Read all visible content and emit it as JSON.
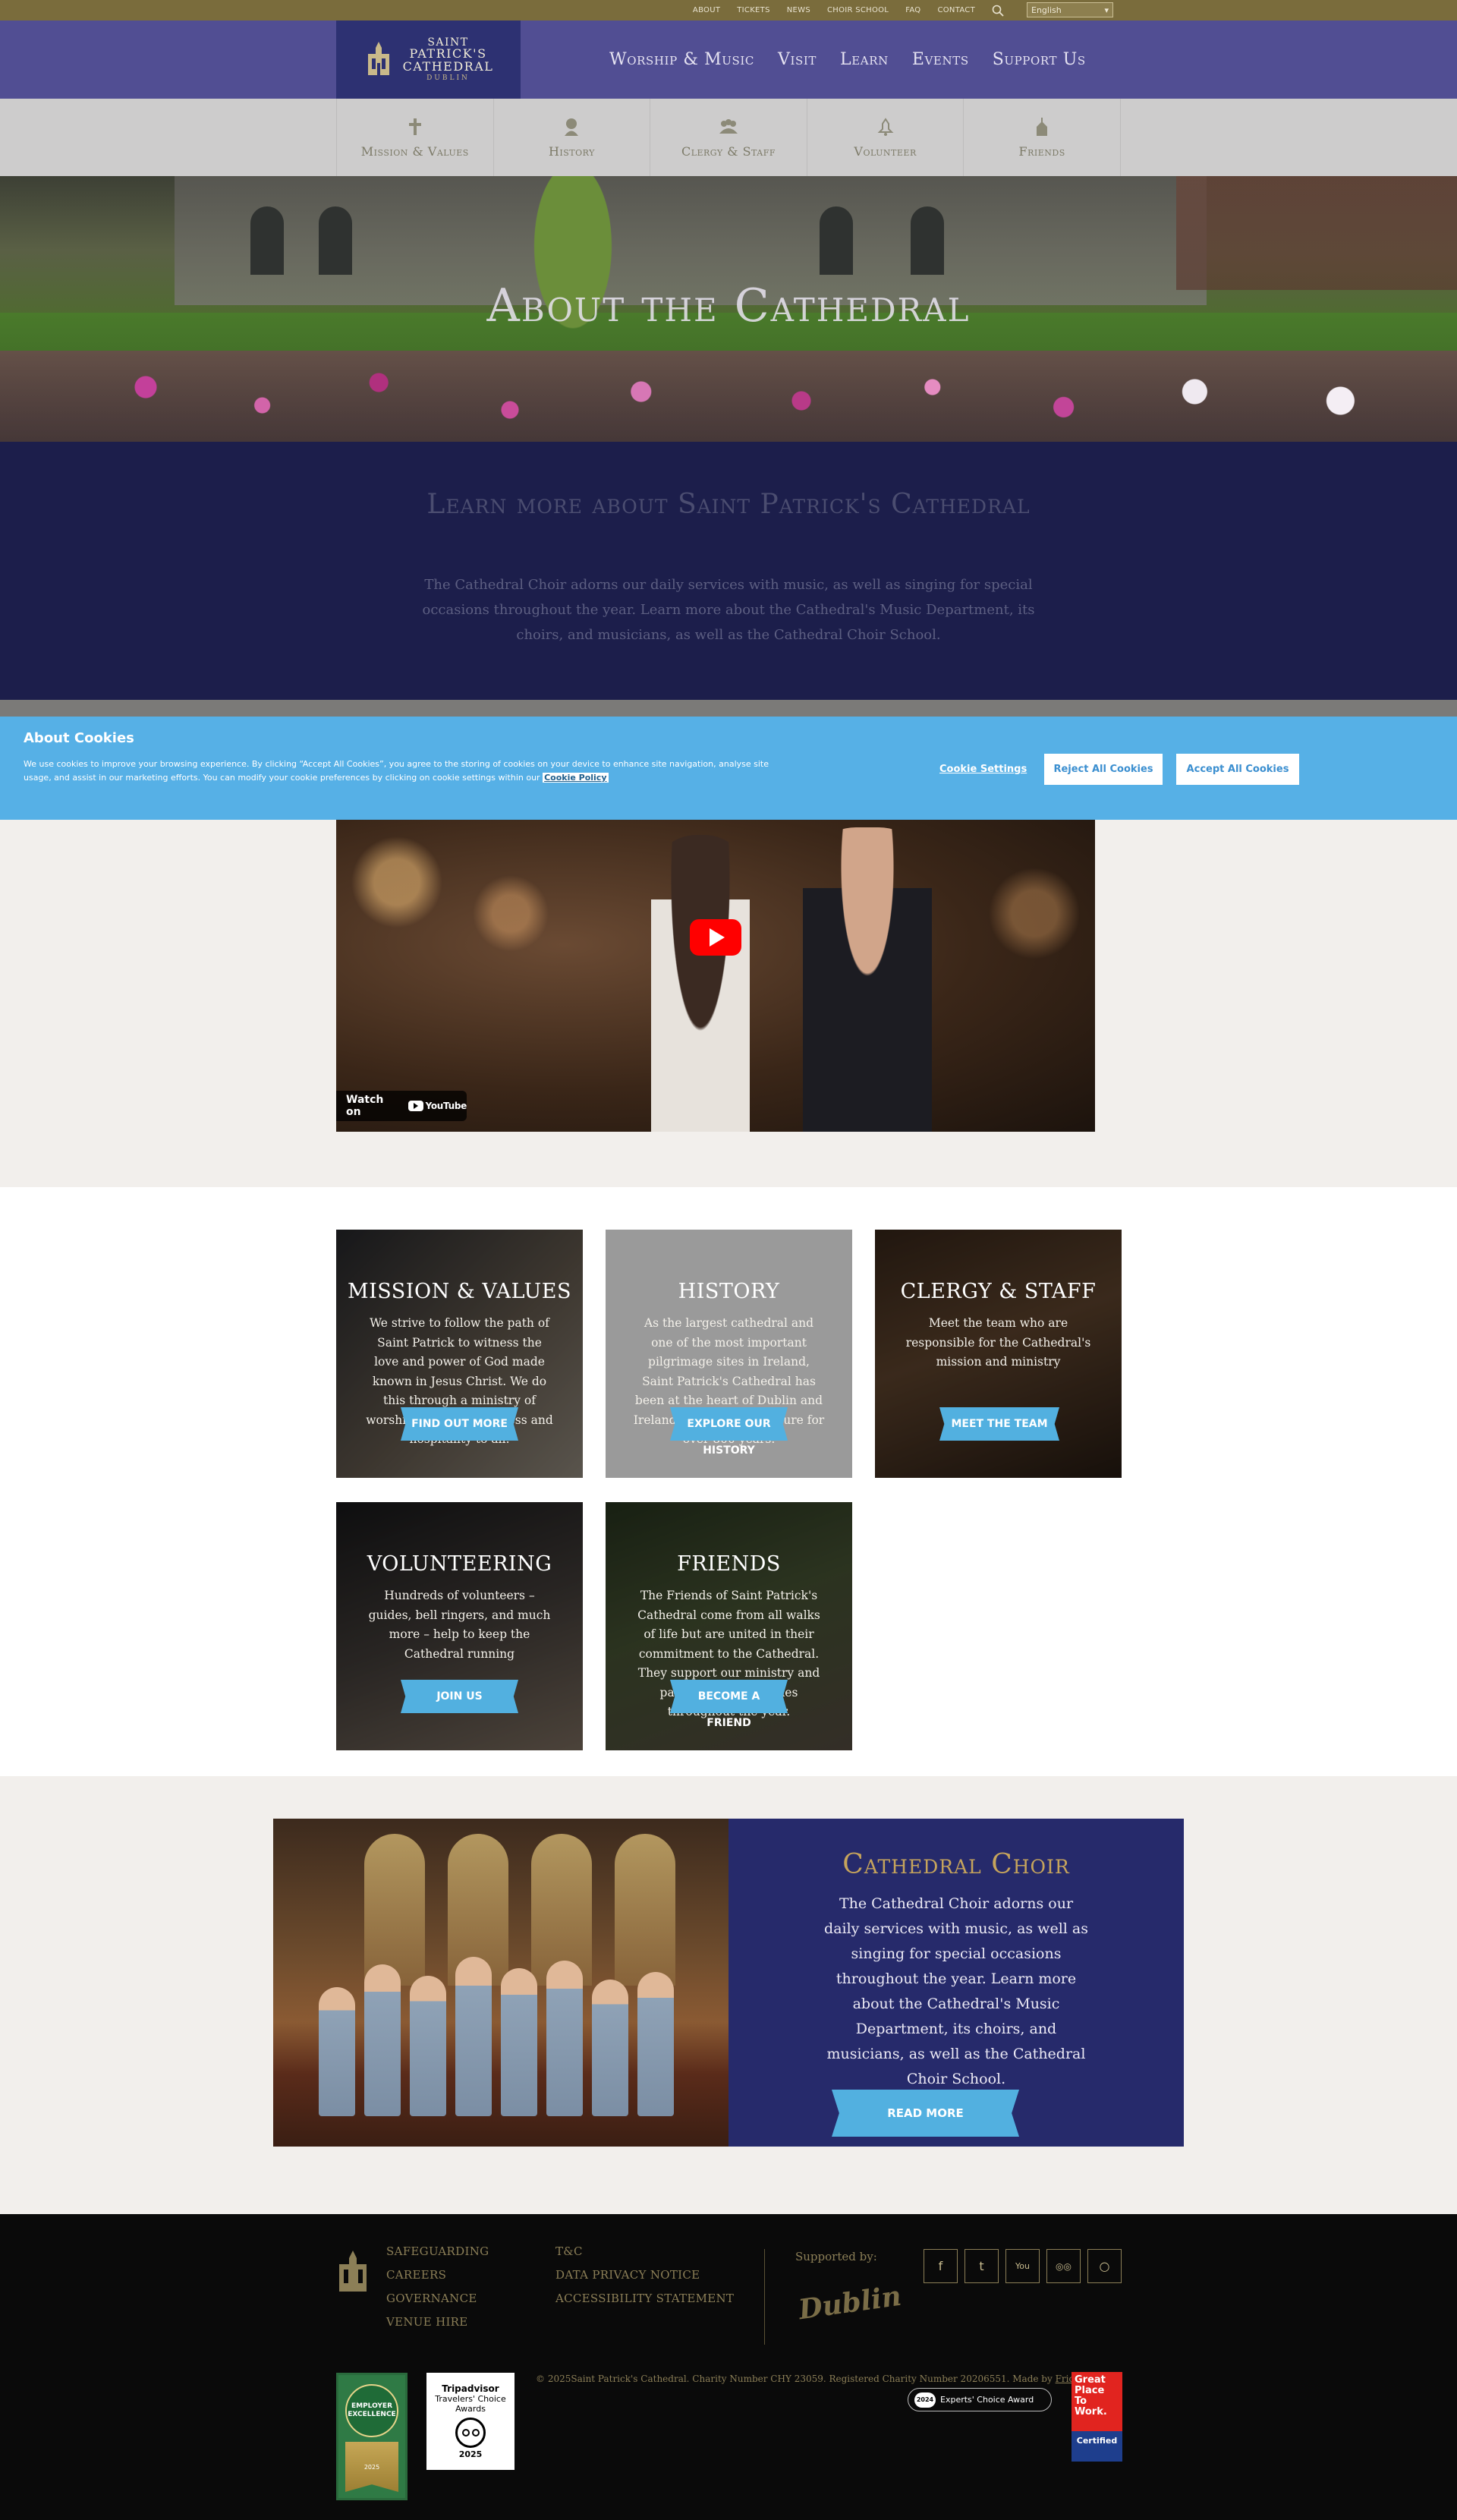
{
  "util_nav": {
    "items": [
      "ABOUT",
      "TICKETS",
      "NEWS",
      "CHOIR SCHOOL",
      "FAQ",
      "CONTACT"
    ],
    "language": "English"
  },
  "logo": {
    "line1": "SAINT",
    "line2": "PATRICK'S",
    "line3": "CATHEDRAL",
    "line4": "DUBLIN"
  },
  "main_nav": [
    "Worship & Music",
    "Visit",
    "Learn",
    "Events",
    "Support Us"
  ],
  "sub_nav": [
    {
      "label": "Mission & Values",
      "icon": "cross-icon"
    },
    {
      "label": "History",
      "icon": "bust-icon"
    },
    {
      "label": "Clergy & Staff",
      "icon": "people-icon"
    },
    {
      "label": "Volunteer",
      "icon": "bell-icon"
    },
    {
      "label": "Friends",
      "icon": "church-icon"
    }
  ],
  "hero": {
    "title": "About the Cathedral"
  },
  "learn": {
    "title": "Learn more about Saint Patrick's Cathedral",
    "text": "The Cathedral Choir adorns our daily services with music, as well as singing for special occasions throughout the year. Learn more about the Cathedral's Music Department, its choirs, and musicians, as well as the Cathedral Choir School."
  },
  "cookie": {
    "title": "About Cookies",
    "text": "We use cookies to improve your browsing experience. By clicking “Accept All Cookies”, you agree to the storing of cookies on your device to enhance site navigation, analyse site usage, and assist in our marketing efforts. You can modify your cookie preferences by clicking on cookie settings within our",
    "policy_link": "Cookie Policy",
    "settings": "Cookie Settings",
    "reject": "Reject All Cookies",
    "accept": "Accept All Cookies"
  },
  "video": {
    "watch_on": "Watch on",
    "youtube": "YouTube"
  },
  "cards": [
    {
      "title": "MISSION & VALUES",
      "text": "We strive to follow the path of Saint Patrick to witness the love and power of God made known in Jesus Christ. We do this through a ministry of worship, learning, holiness and hospitality to all.",
      "button": "FIND OUT MORE",
      "button2": ""
    },
    {
      "title": "HISTORY",
      "text": "As the largest cathedral and one of the most important pilgrimage sites in Ireland, Saint Patrick's Cathedral has been at the heart of Dublin and Ireland's history and culture for over 800 years.",
      "button": "EXPLORE OUR",
      "button2": "HISTORY"
    },
    {
      "title": "CLERGY & STAFF",
      "text": "Meet the team who are responsible for the Cathedral's mission and ministry",
      "button": "MEET THE TEAM",
      "button2": ""
    },
    {
      "title": "VOLUNTEERING",
      "text": "Hundreds of volunteers – guides, bell ringers, and much more – help to keep the Cathedral running",
      "button": "JOIN US",
      "button2": ""
    },
    {
      "title": "FRIENDS",
      "text": "The Friends of Saint Patrick's Cathedral come from all walks of life but are united in their commitment to the Cathedral. They support our ministry and participate in activities throughout the year.",
      "button": "BECOME A",
      "button2": "FRIEND"
    }
  ],
  "choir": {
    "title": "Cathedral Choir",
    "text": "The Cathedral Choir adorns our daily services with music, as well as singing for special occasions throughout the year. Learn more about the Cathedral's Music Department, its choirs, and musicians, as well as the Cathedral Choir School.",
    "button": "READ MORE"
  },
  "footer": {
    "links_col1": [
      "SAFEGUARDING",
      "CAREERS",
      "GOVERNANCE",
      "VENUE HIRE"
    ],
    "links_col2": [
      "T&C",
      "DATA PRIVACY NOTICE",
      "ACCESSIBILITY STATEMENT"
    ],
    "supported_by": "Supported by:",
    "dublin_logo": "Dublin",
    "socials": [
      {
        "name": "facebook-icon",
        "glyph": "f"
      },
      {
        "name": "twitter-icon",
        "glyph": "t"
      },
      {
        "name": "youtube-icon",
        "glyph": "You"
      },
      {
        "name": "tripadvisor-icon",
        "glyph": "◎◎"
      },
      {
        "name": "instagram-icon",
        "glyph": "○"
      }
    ],
    "copyright": "©  2025Saint Patrick's Cathedral. Charity Number CHY 23059. Registered Charity Number 20206551.  Made by",
    "made_by": "Friday",
    "experts_year": "2024",
    "experts_label": "Experts' Choice Award",
    "employer_badge": "EMPLOYER EXCELLENCE",
    "employer_year": "2025",
    "trip_title": "Tripadvisor",
    "trip_sub": "Travelers' Choice Awards",
    "trip_year": "2025",
    "gptw_title": "Great Place To Work.",
    "gptw_cert": "Certified"
  }
}
